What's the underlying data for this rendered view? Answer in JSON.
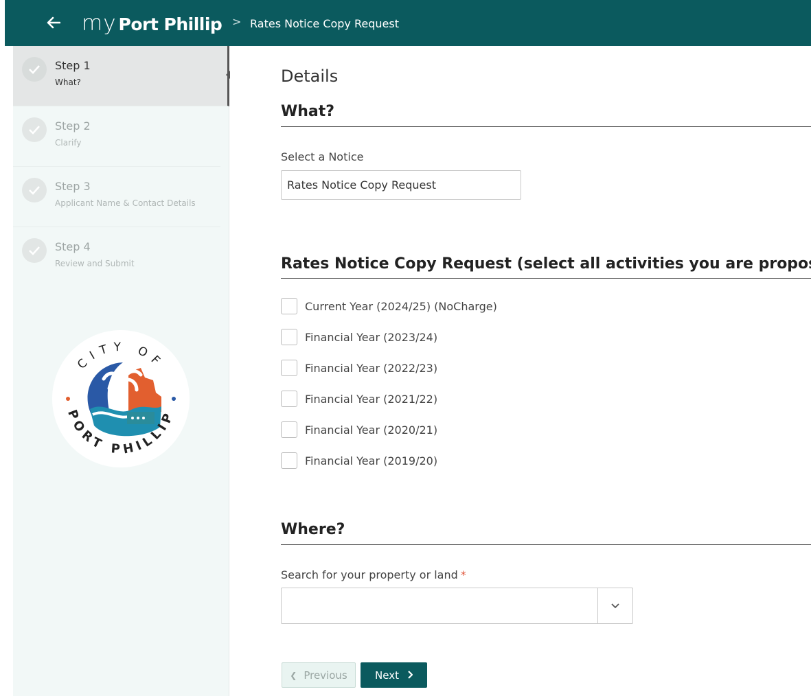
{
  "header": {
    "logo_my": "my",
    "logo_brand": "Port Phillip",
    "separator": ">",
    "breadcrumb": "Rates Notice Copy Request"
  },
  "sidebar": {
    "steps": [
      {
        "title": "Step 1",
        "subtitle": "What?",
        "active": true
      },
      {
        "title": "Step 2",
        "subtitle": "Clarify",
        "active": false
      },
      {
        "title": "Step 3",
        "subtitle": "Applicant Name & Contact Details",
        "active": false
      },
      {
        "title": "Step 4",
        "subtitle": "Review and Submit",
        "active": false
      }
    ],
    "seal": {
      "top_text": "CITY OF",
      "bottom_text": "PORT PHILLIP"
    }
  },
  "main": {
    "page_heading": "Details",
    "what_heading": "What?",
    "notice_label": "Select a Notice",
    "notice_value": "Rates Notice Copy Request",
    "activities_heading": "Rates Notice Copy Request (select all activities you are proposing)",
    "options": [
      "Current Year (2024/25) (NoCharge)",
      "Financial Year (2023/24)",
      "Financial Year (2022/23)",
      "Financial Year (2021/22)",
      "Financial Year (2020/21)",
      "Financial Year (2019/20)"
    ],
    "where_heading": "Where?",
    "property_label": "Search for your property or land",
    "required_mark": "*",
    "property_value": "",
    "previous_label": "Previous",
    "next_label": "Next"
  },
  "colors": {
    "brand": "#0b5a5e",
    "sidebar_bg": "#f2f8f7",
    "required": "#e0553a"
  }
}
